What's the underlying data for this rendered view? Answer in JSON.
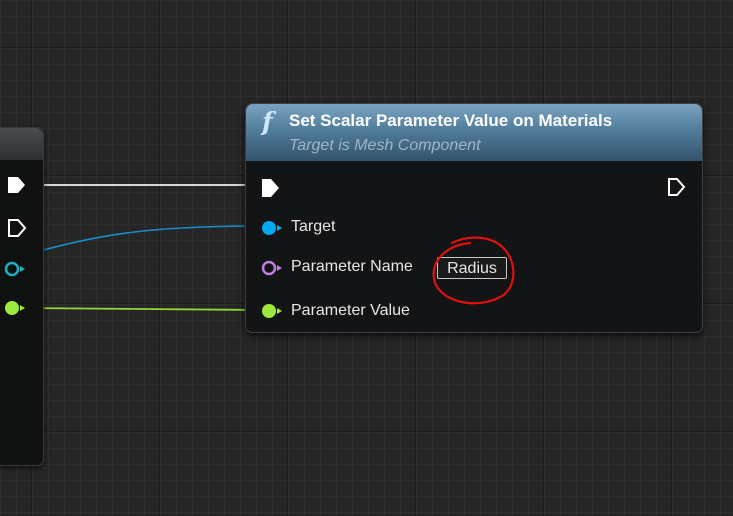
{
  "node": {
    "title": "Set Scalar Parameter Value on Materials",
    "subtitle": "Target is Mesh Component",
    "function_icon": "f"
  },
  "pins": {
    "target_label": "Target",
    "parameter_name_label": "Parameter Name",
    "parameter_name_value": "Radius",
    "parameter_value_label": "Parameter Value"
  },
  "colors": {
    "exec_pin": "#ffffff",
    "object_pin": "#00a8f0",
    "name_pin": "#c07ee0",
    "float_pin": "#9de83c",
    "annotation_circle": "#e01010",
    "header_top": "#7aa3c0",
    "header_bottom": "#33536b"
  },
  "icons": [
    "function-icon",
    "exec-in-pin-icon",
    "exec-out-pin-icon",
    "object-pin-icon",
    "name-pin-icon",
    "float-pin-icon"
  ]
}
